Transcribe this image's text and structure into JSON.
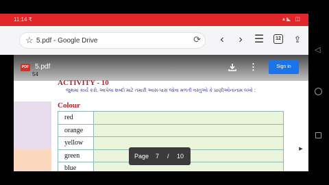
{
  "status_bar": {
    "time": "11:14 ₹",
    "right_icons": "▴◣ ◫"
  },
  "browser": {
    "page_title": "5.pdf - Google Drive",
    "tab_count": "12",
    "icons": [
      "star-icon",
      "reload-icon",
      "back-icon",
      "forward-icon",
      "menu-icon",
      "tabs-icon",
      "upload-icon"
    ]
  },
  "viewer": {
    "pdf_badge": "PDF",
    "file_name": "5.pdf",
    "page_printed": "54",
    "signin_label": "Sign in"
  },
  "document": {
    "activity_title": "ACTIVITY - 10",
    "instruction": "જુથમાં કાર્ય કરો. આપેલા શબ્દો માટે તમારી આસ-પાસ જોવા મળતી વસ્તુઓ કે પ્રાણીઓનાંનામ લખો :",
    "section_heading": "Colour",
    "colours": [
      "red",
      "orange",
      "yellow",
      "green",
      "blue"
    ]
  },
  "page_indicator": {
    "label": "Page",
    "current": "7",
    "separator": "/",
    "total": "10"
  },
  "overlay": {
    "watermark": "",
    "yt_logo": ""
  },
  "colors": {
    "status_red": "#e2272a",
    "signin_blue": "#1a73e8",
    "heading_red": "#b3202b",
    "row_green": "#eaf5dc"
  }
}
